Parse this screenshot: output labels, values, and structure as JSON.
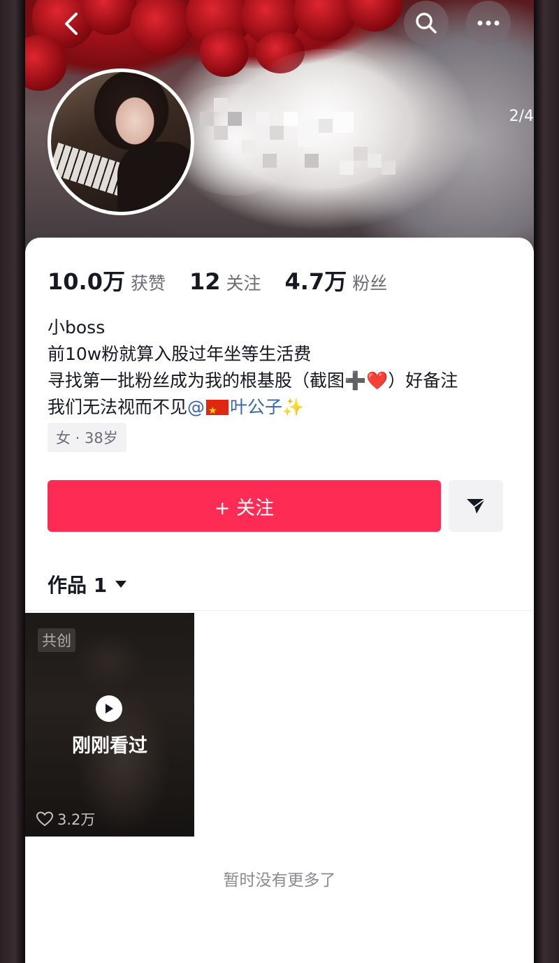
{
  "header": {
    "page_indicator": "2/4",
    "back_icon": "back-chevron-icon",
    "search_icon": "search-icon",
    "more_icon": "more-dots-icon"
  },
  "profile": {
    "username_obscured": true
  },
  "stats": [
    {
      "value": "10.0万",
      "label": "获赞"
    },
    {
      "value": "12",
      "label": "关注"
    },
    {
      "value": "4.7万",
      "label": "粉丝"
    }
  ],
  "bio": {
    "line1": "小boss",
    "line2": "前10w粉就算入股过年坐等生活费",
    "line3_prefix": "寻找第一批粉丝成为我的根基股（截图",
    "line3_plus": "➕",
    "line3_heart": "❤️",
    "line3_suffix": "）好备注",
    "line4_prefix": "我们无法视而不见",
    "line4_at": "@",
    "line4_mention": "叶公子",
    "line4_sparkle": "✨"
  },
  "tag": "女 · 38岁",
  "actions": {
    "follow_label": "+ 关注",
    "share_icon": "send-icon"
  },
  "works": {
    "tab_label": "作品 1",
    "video": {
      "badge": "共创",
      "status": "刚刚看过",
      "likes": "3.2万"
    }
  },
  "footer_text": "暂时没有更多了",
  "colors": {
    "accent": "#fe2c55",
    "text_primary": "#161823",
    "text_secondary": "#6b6d75",
    "mention": "#3a66a8"
  }
}
